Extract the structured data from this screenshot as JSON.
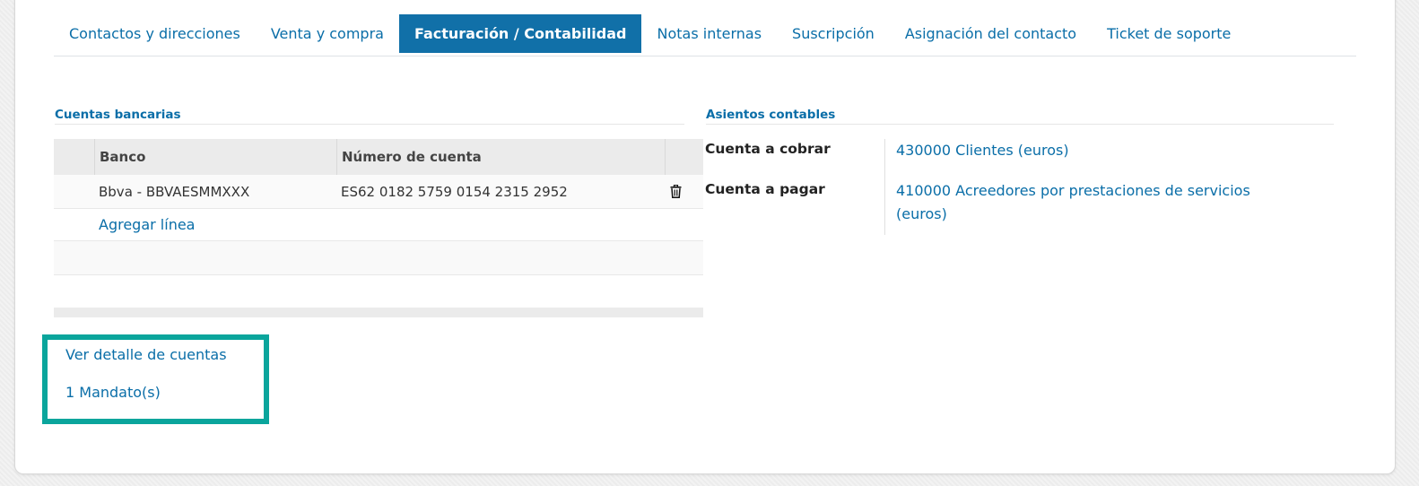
{
  "tabs": [
    {
      "label": "Contactos y direcciones",
      "active": false
    },
    {
      "label": "Venta y compra",
      "active": false
    },
    {
      "label": "Facturación / Contabilidad",
      "active": true
    },
    {
      "label": "Notas internas",
      "active": false
    },
    {
      "label": "Suscripción",
      "active": false
    },
    {
      "label": "Asignación del contacto",
      "active": false
    },
    {
      "label": "Ticket de soporte",
      "active": false
    }
  ],
  "bank_accounts": {
    "title": "Cuentas bancarias",
    "columns": [
      "Banco",
      "Número de cuenta"
    ],
    "rows": [
      {
        "bank": "Bbva - BBVAESMMXXX",
        "account_number": "ES62 0182 5759 0154 2315 2952"
      }
    ],
    "add_line": "Agregar línea"
  },
  "accounting": {
    "title": "Asientos contables",
    "receivable_label": "Cuenta a cobrar",
    "receivable_value": "430000 Clientes (euros)",
    "payable_label": "Cuenta a pagar",
    "payable_value": "410000 Acreedores por prestaciones de servicios (euros)"
  },
  "links": {
    "account_details": "Ver detalle de cuentas",
    "mandates": "1 Mandato(s)"
  },
  "colors": {
    "accent": "#0a6ea8",
    "active_tab": "#1170a8",
    "highlight_border": "#0aa59c"
  }
}
